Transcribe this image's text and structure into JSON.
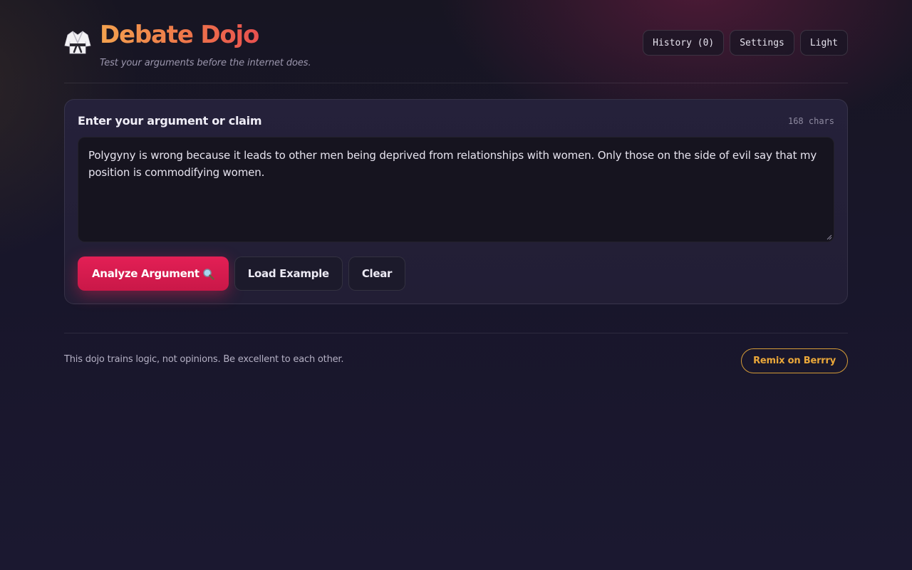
{
  "header": {
    "title": "Debate Dojo",
    "tagline": "Test your arguments before the internet does.",
    "logo_icon": "karate-gi-icon",
    "actions": {
      "history_label": "History (0)",
      "settings_label": "Settings",
      "theme_label": "Light"
    }
  },
  "input_card": {
    "label": "Enter your argument or claim",
    "char_count": "168 chars",
    "argument_value": "Polygyny is wrong because it leads to other men being deprived from relationships with women. Only those on the side of evil say that my position is commodifying women.",
    "buttons": {
      "analyze_label": "Analyze Argument",
      "analyze_icon": "magnifying-glass-icon",
      "load_example_label": "Load Example",
      "clear_label": "Clear"
    }
  },
  "footer": {
    "note": "This dojo trains logic, not opinions. Be excellent to each other.",
    "remix_label": "Remix on Berrry"
  },
  "colors": {
    "accent": "#e31f55",
    "title_gradient_start": "#f3a24f",
    "title_gradient_end": "#e8514f",
    "remix_gold": "#eba83a",
    "background": "#18162a"
  }
}
